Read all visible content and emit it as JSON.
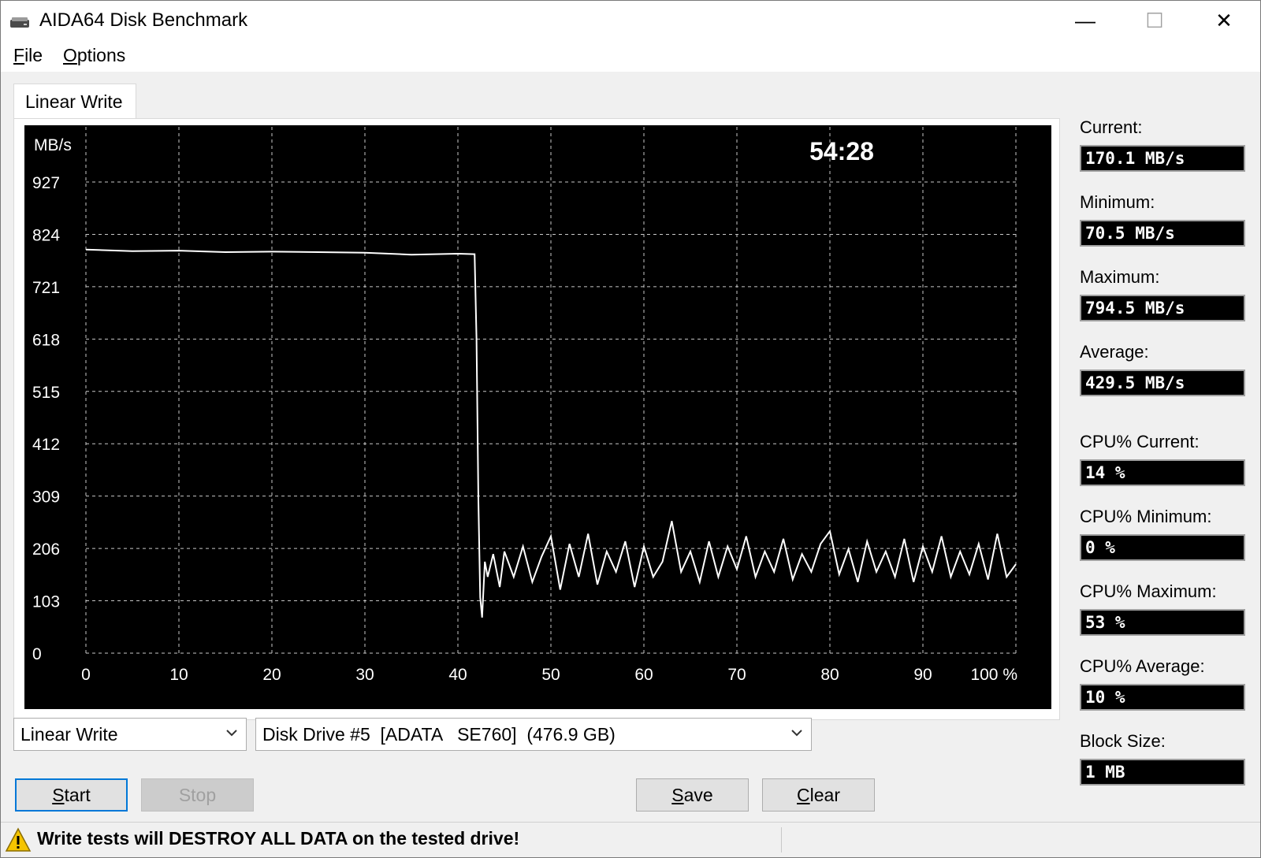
{
  "window": {
    "title": "AIDA64 Disk Benchmark",
    "controls": {
      "minimize": "—",
      "maximize": "☐",
      "close": "✕"
    }
  },
  "menu": [
    {
      "mnemonic": "F",
      "rest": "ile"
    },
    {
      "mnemonic": "O",
      "rest": "ptions"
    }
  ],
  "tab": {
    "label": "Linear Write"
  },
  "chart": {
    "elapsed": "54:28",
    "ylabel": "MB/s",
    "x_unit": "%",
    "line_color": "#ffffff",
    "grid_color": "#c8c8c8",
    "background_color": "#000000"
  },
  "chart_data": {
    "type": "line",
    "ylabel": "MB/s",
    "ylim": [
      0,
      927
    ],
    "yticks": [
      0,
      103,
      206,
      309,
      412,
      515,
      618,
      721,
      824,
      927
    ],
    "xlim": [
      0,
      100
    ],
    "xticks": [
      0,
      10,
      20,
      30,
      40,
      50,
      60,
      70,
      80,
      90,
      100
    ],
    "xtick_labels": [
      "0",
      "10",
      "20",
      "30",
      "40",
      "50",
      "60",
      "70",
      "80",
      "90",
      "100 %"
    ],
    "grid": true,
    "series": [
      {
        "x": [
          0,
          5,
          10,
          15,
          20,
          25,
          30,
          35,
          40,
          41.8,
          42.0,
          42.2,
          42.4,
          42.6,
          42.9,
          43.2,
          43.8,
          44.5,
          45,
          46,
          47,
          48,
          49,
          50,
          51,
          52,
          53,
          54,
          55,
          56,
          57,
          58,
          59,
          60,
          61,
          62,
          63,
          64,
          65,
          66,
          67,
          68,
          69,
          70,
          71,
          72,
          73,
          74,
          75,
          76,
          77,
          78,
          79,
          80,
          81,
          82,
          83,
          84,
          85,
          86,
          87,
          88,
          89,
          90,
          91,
          92,
          93,
          94,
          95,
          96,
          97,
          98,
          99,
          100
        ],
        "y": [
          794,
          791,
          792,
          789,
          790,
          789,
          788,
          784,
          786,
          785,
          620,
          300,
          110,
          70,
          180,
          150,
          195,
          130,
          200,
          150,
          210,
          140,
          190,
          230,
          125,
          215,
          150,
          235,
          135,
          200,
          160,
          220,
          130,
          210,
          150,
          180,
          260,
          160,
          200,
          140,
          220,
          150,
          210,
          165,
          230,
          150,
          200,
          160,
          225,
          145,
          195,
          160,
          215,
          240,
          155,
          205,
          140,
          220,
          160,
          200,
          150,
          225,
          140,
          210,
          160,
          230,
          150,
          200,
          155,
          215,
          145,
          235,
          150,
          175
        ]
      }
    ]
  },
  "stats": [
    {
      "label": "Current:",
      "value": "170.1 MB/s"
    },
    {
      "label": "Minimum:",
      "value": "70.5 MB/s"
    },
    {
      "label": "Maximum:",
      "value": "794.5 MB/s"
    },
    {
      "label": "Average:",
      "value": "429.5 MB/s"
    },
    {
      "label": "CPU% Current:",
      "value": "14 %"
    },
    {
      "label": "CPU% Minimum:",
      "value": "0 %"
    },
    {
      "label": "CPU% Maximum:",
      "value": "53 %"
    },
    {
      "label": "CPU% Average:",
      "value": "10 %"
    },
    {
      "label": "Block Size:",
      "value": "1 MB"
    }
  ],
  "controls": {
    "test_select": "Linear Write",
    "drive_select": "Disk Drive #5  [ADATA   SE760]  (476.9 GB)",
    "start": {
      "mnemonic": "S",
      "rest": "tart"
    },
    "stop": "Stop",
    "save": {
      "mnemonic": "S",
      "rest": "ave"
    },
    "clear": {
      "mnemonic": "C",
      "rest": "lear"
    }
  },
  "status": {
    "warning": "Write tests will DESTROY ALL DATA on the tested drive!",
    "warning_color": "#f5c400"
  }
}
